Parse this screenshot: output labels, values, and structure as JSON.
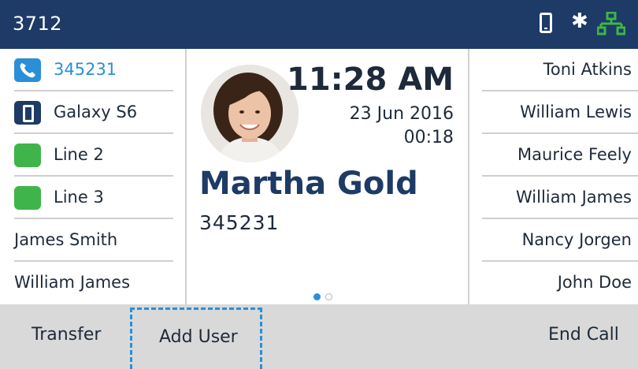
{
  "status_bar": {
    "extension": "3712",
    "icons": [
      "mobile-device-icon",
      "bluetooth-icon",
      "network-icon"
    ],
    "network_color": "#3fb44b"
  },
  "line_keys": [
    {
      "label": "345231",
      "type": "call-active",
      "icon": "phone-handset-icon"
    },
    {
      "label": "Galaxy S6",
      "type": "mobile",
      "icon": "mobile-device-icon"
    },
    {
      "label": "Line 2",
      "type": "line",
      "icon": "line-status-icon"
    },
    {
      "label": "Line 3",
      "type": "line",
      "icon": "line-status-icon"
    },
    {
      "label": "James Smith",
      "type": "contact"
    },
    {
      "label": "William James",
      "type": "contact"
    }
  ],
  "call": {
    "time": "11:28 AM",
    "date": "23 Jun 2016",
    "duration": "00:18",
    "caller_name": "Martha Gold",
    "caller_number": "345231",
    "page_count": 2,
    "current_page": 1
  },
  "speed_dials": [
    {
      "label": "Toni Atkins"
    },
    {
      "label": "William Lewis"
    },
    {
      "label": "Maurice Feely"
    },
    {
      "label": "William James"
    },
    {
      "label": "Nancy Jorgen"
    },
    {
      "label": "John Doe"
    }
  ],
  "softkeys": {
    "transfer": "Transfer",
    "add_user": "Add User",
    "end_call": "End Call"
  },
  "colors": {
    "header_bg": "#1e3a66",
    "accent": "#2a8fd6",
    "line_indicator": "#3fb44b",
    "softkey_bg": "#d9d9d9"
  }
}
